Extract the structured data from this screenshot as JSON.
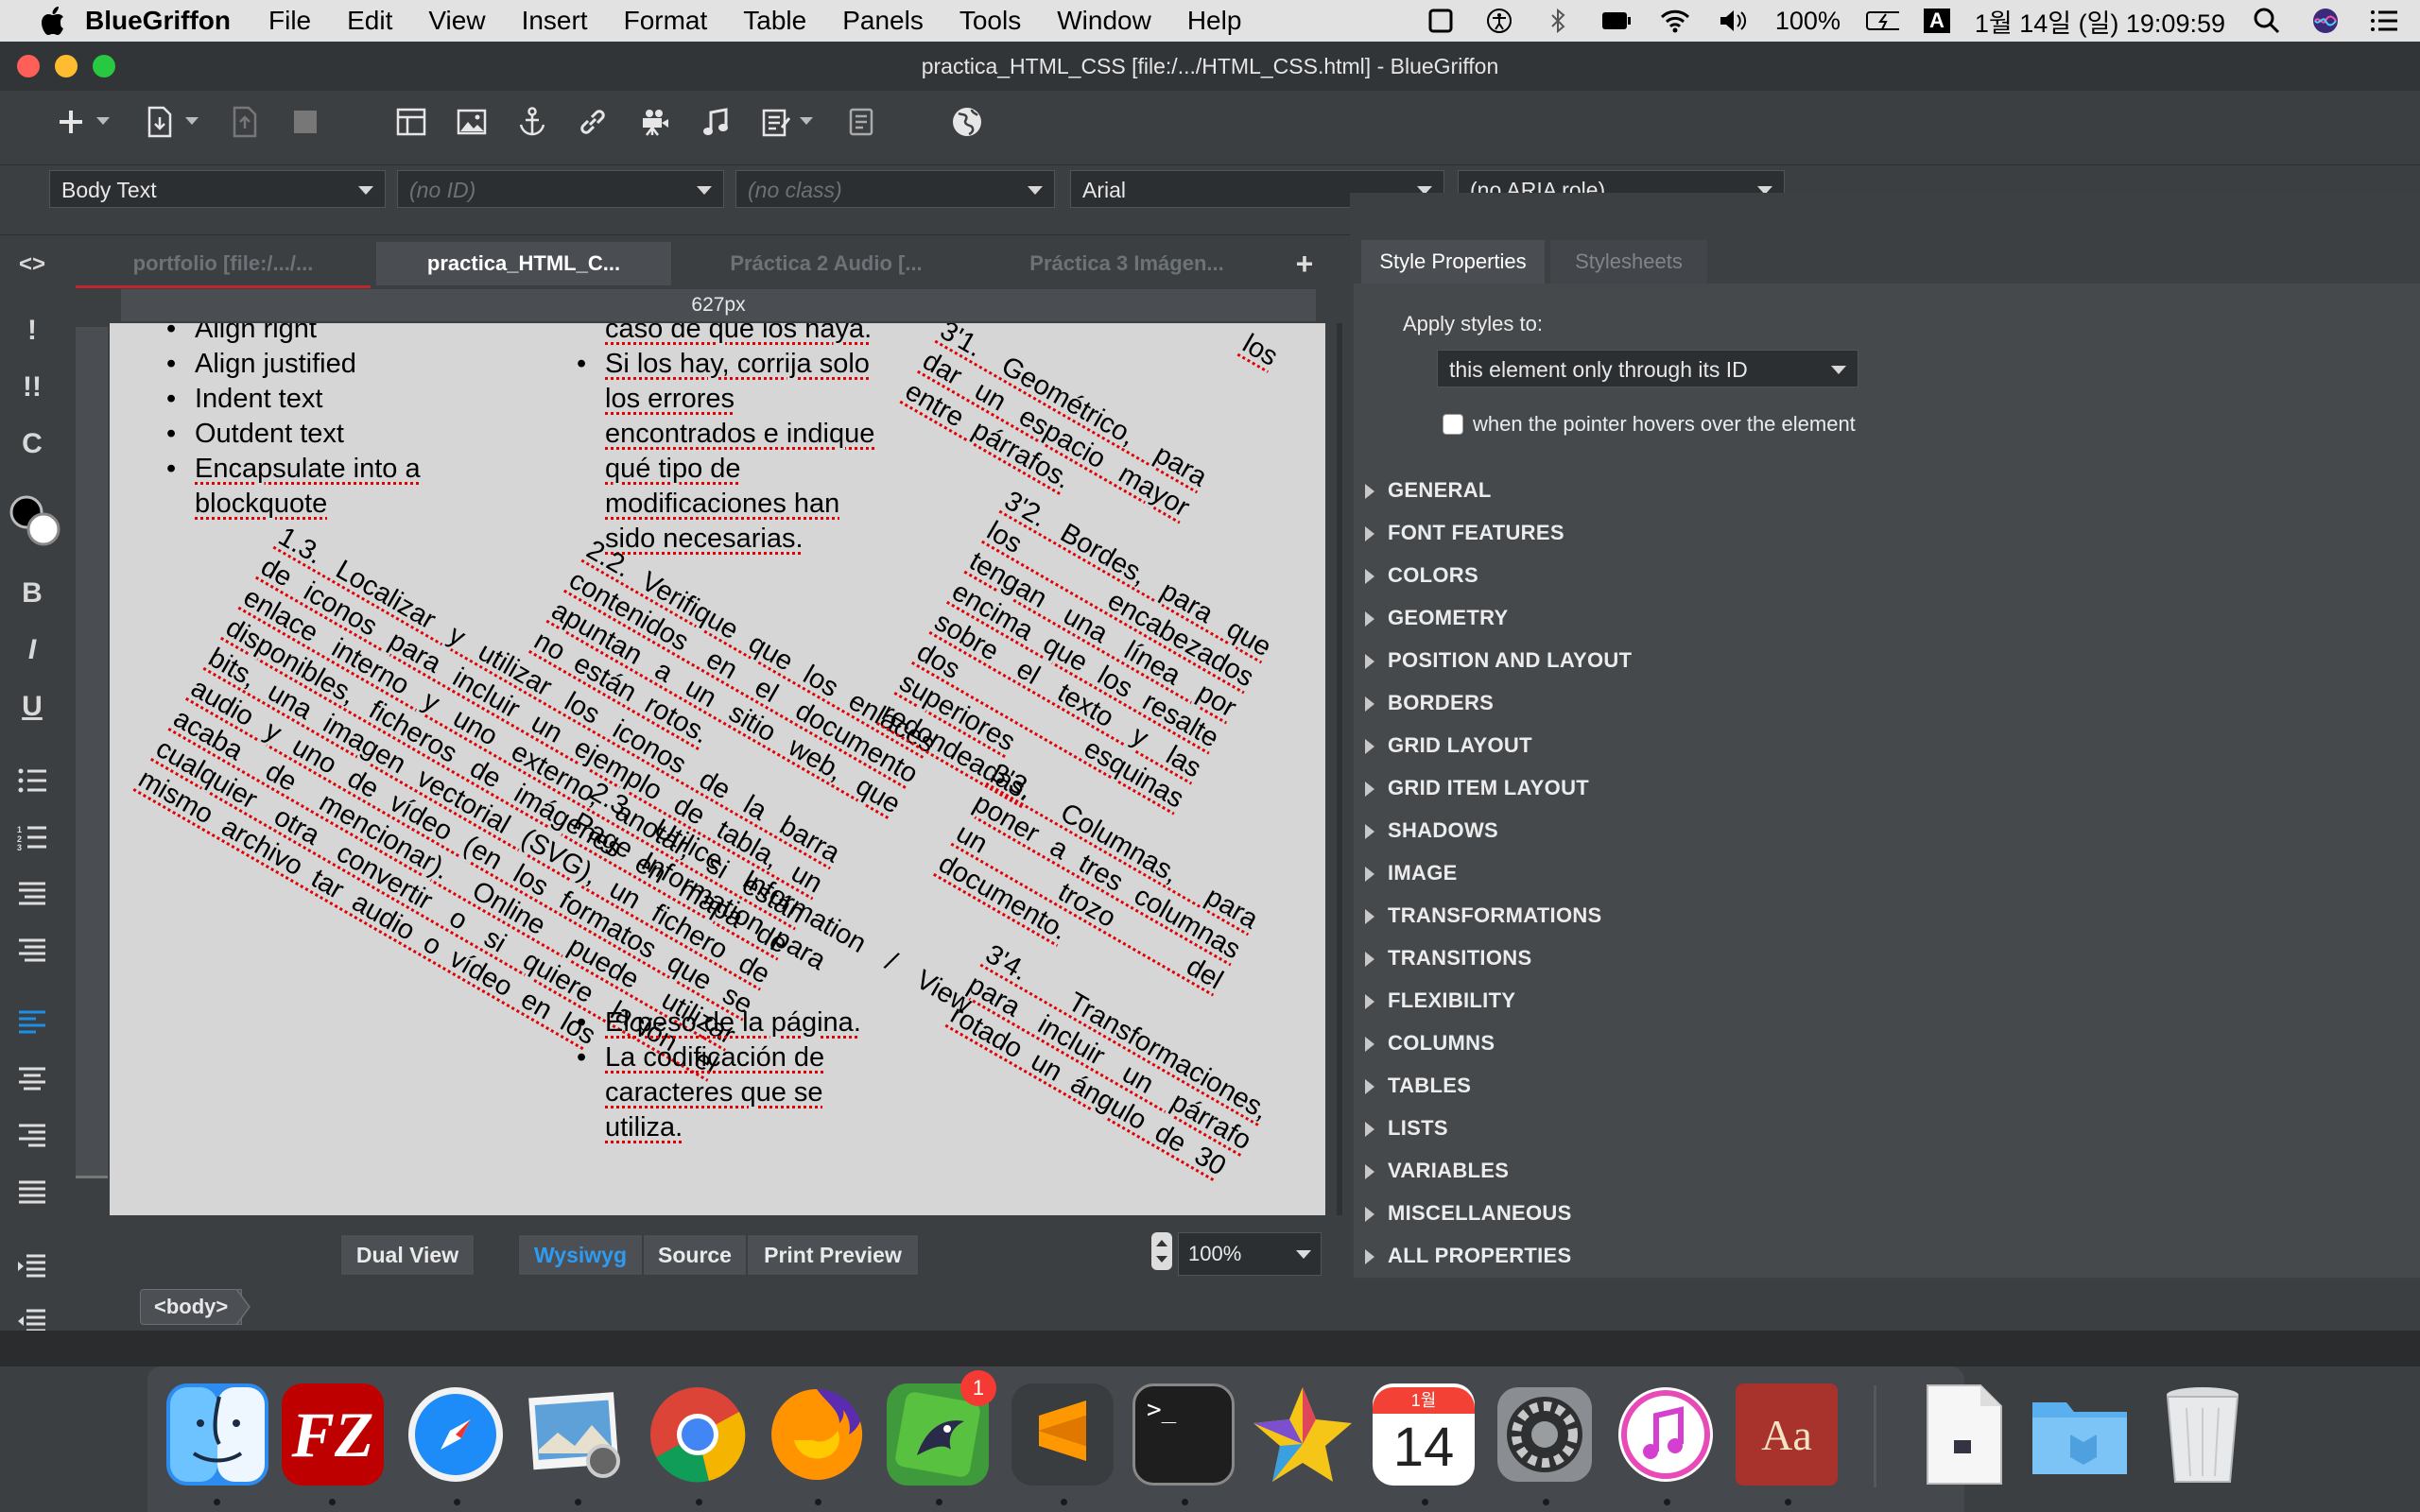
{
  "menubar": {
    "app": "BlueGriffon",
    "items": [
      "File",
      "Edit",
      "View",
      "Insert",
      "Format",
      "Table",
      "Panels",
      "Tools",
      "Window",
      "Help"
    ],
    "battery": "100%",
    "input_source": "A",
    "clock": "1월 14일 (일)  19:09:59"
  },
  "window": {
    "title": "practica_HTML_CSS [file:/.../HTML_CSS.html] - BlueGriffon"
  },
  "format_bar": {
    "paragraph": "Body Text",
    "id": "(no ID)",
    "class": "(no class)",
    "font": "Arial",
    "aria": "(no ARIA role)"
  },
  "tabs": [
    {
      "label": "portfolio [file:/.../..."
    },
    {
      "label": "practica_HTML_C..."
    },
    {
      "label": "Práctica 2 Audio [..."
    },
    {
      "label": "Práctica 3 Imágen..."
    }
  ],
  "add_tab": "+",
  "ruler": {
    "width_label": "627px"
  },
  "document": {
    "list1": [
      "Align right",
      "Align justified",
      "Indent text",
      "Outdent text",
      "Encapsulate into a blockquote"
    ],
    "para_1_3": "1.3. Localizar y utilizar los iconos de la barra de iconos para incluir un ejemplo de tabla, un enlace interno y uno externo, anotar, si están disponibles, ficheros de imágenes en mapa de bits, una imagen vectorial (SVG), un fichero de audio y uno de vídeo (en los formatos que se acaba de mencionar). Online puede utilizar cualquier otra convertir o si quiere lación el mismo archivo tar audio o vídeo en los",
    "list2_top": "caso de que los haya.",
    "list2": [
      "Si los hay, corrija solo los errores encontrados e indique qué tipo de modificaciones han sido necesarias."
    ],
    "para_2_2": "2.2. Verifique que los enlaces contenidos en el documento apuntan a un sitio web, que no están rotos.",
    "para_2_3": "2.3. Utilice Information / View Page Information para",
    "list3": [
      "El peso de la página.",
      "La codificación de caracteres que se utiliza."
    ],
    "para_3_top": "los",
    "para_3_1": "3'1. Geométrico, para dar un espacio mayor entre párrafos.",
    "para_3_2": "3'2. Bordes, para que los encabezados tengan una línea por encima que los resalte sobre el texto y las dos esquinas superiores redondeadas.",
    "para_3_3": "3'3. Columnas, para poner a tres columnas un trozo del documento.",
    "para_3_4": "3'4. Transformaciones, para incluir un párrafo rotado un ángulo de 30"
  },
  "view_modes": {
    "dual": "Dual View",
    "wysiwyg": "Wysiwyg",
    "source": "Source",
    "print": "Print Preview"
  },
  "zoom": "100%",
  "breadcrumb": "<body>",
  "style_panel": {
    "tabs": [
      "Style Properties",
      "Stylesheets"
    ],
    "apply_label": "Apply styles to:",
    "apply_value": "this element only through its ID",
    "hover_label": "when the pointer hovers over the element",
    "sections": [
      "GENERAL",
      "FONT FEATURES",
      "COLORS",
      "GEOMETRY",
      "POSITION AND LAYOUT",
      "BORDERS",
      "GRID LAYOUT",
      "GRID ITEM LAYOUT",
      "SHADOWS",
      "IMAGE",
      "TRANSFORMATIONS",
      "TRANSITIONS",
      "FLEXIBILITY",
      "COLUMNS",
      "TABLES",
      "LISTS",
      "VARIABLES",
      "MISCELLANEOUS",
      "ALL PROPERTIES"
    ]
  },
  "dock": {
    "calendar_month": "1월",
    "calendar_day": "14",
    "badge": "1",
    "dictionary_label": "Aa",
    "terminal_prompt": ">_",
    "filezilla_label": "FZ",
    "apps": [
      "finder-icon",
      "filezilla-icon",
      "safari-icon",
      "preview-icon",
      "chrome-icon",
      "firefox-icon",
      "bluegriffon-icon",
      "sublime-icon",
      "terminal-icon",
      "imovie-star-icon",
      "calendar-icon",
      "system-preferences-icon",
      "itunes-icon",
      "dictionary-icon",
      "document-icon",
      "folder-icon",
      "trash-icon"
    ]
  }
}
